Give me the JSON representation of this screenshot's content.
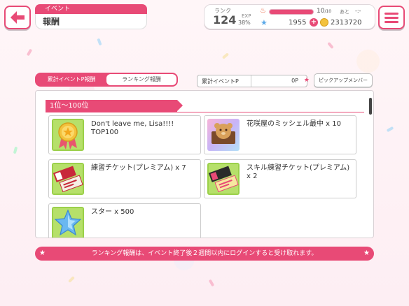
{
  "header": {
    "category": "イベント",
    "title": "報酬"
  },
  "status": {
    "rank_label": "ランク",
    "rank": "124",
    "exp_label": "EXP",
    "exp_percent": "38%",
    "stamina": "10",
    "stamina_max": "/10",
    "stamina_fill": 1.0,
    "recover_label": "あと",
    "recover_time": "-:-",
    "gems": "1955",
    "coins": "2313720"
  },
  "tabs": [
    {
      "label": "累計イベントP報酬"
    },
    {
      "label": "ランキング報酬"
    }
  ],
  "points": {
    "label": "累計イベントP",
    "value": "0P"
  },
  "pickup_button": "ピックアップメンバー",
  "rewards": {
    "range": "1位〜100位",
    "items": [
      {
        "name": "Don't leave me, Lisa!!!! TOP100",
        "icon": "medal-icon"
      },
      {
        "name": "花咲屋のミッシェル最中 x 10",
        "icon": "michelle-monaka-icon"
      },
      {
        "name": "練習チケット(プレミアム) x 7",
        "icon": "premium-practice-ticket-icon"
      },
      {
        "name": "スキル練習チケット(プレミアム) x 2",
        "icon": "skill-practice-ticket-icon"
      },
      {
        "name": "スター x 500",
        "icon": "star-icon"
      }
    ]
  },
  "notice": "ランキング報酬は、イベント終了後２週間以内にログインすると受け取れます。",
  "colors": {
    "accent": "#e84a76",
    "background": "#fdf3f6"
  }
}
